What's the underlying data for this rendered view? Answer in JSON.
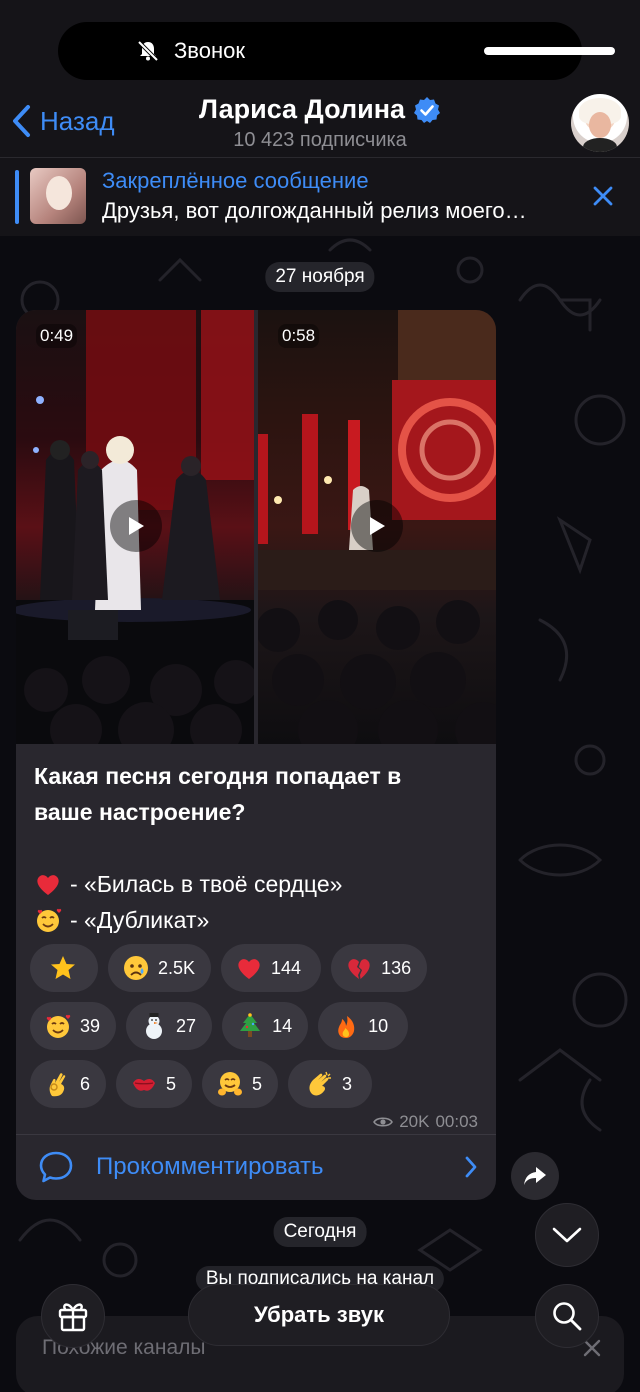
{
  "status_pill": {
    "text": "Звонок",
    "icon": "bell-slash-icon"
  },
  "header": {
    "back_label": "Назад",
    "title": "Лариса Долина",
    "subtitle": "10 423 подписчика",
    "accent": "#3e8cf6"
  },
  "pinned": {
    "title": "Закреплённое сообщение",
    "text": "Друзья, вот долгожданный релиз моего…"
  },
  "date_separator": "27 ноября",
  "post": {
    "videos": [
      {
        "duration": "0:49"
      },
      {
        "duration": "0:58"
      }
    ],
    "question_line1": "Какая песня сегодня попадает в",
    "question_line2": "ваше настроение?",
    "options": [
      {
        "emoji": "red-heart",
        "text": "- «Билась в твоё сердце»"
      },
      {
        "emoji": "smiling-face-with-hearts",
        "text": "- «Дубликат»"
      }
    ],
    "reactions": [
      {
        "emoji": "star",
        "count": ""
      },
      {
        "emoji": "crying-face",
        "count": "2.5K"
      },
      {
        "emoji": "red-heart",
        "count": "144"
      },
      {
        "emoji": "broken-heart",
        "count": "136"
      },
      {
        "emoji": "smiling-face-with-hearts",
        "count": "39"
      },
      {
        "emoji": "snowman",
        "count": "27"
      },
      {
        "emoji": "christmas-tree",
        "count": "14"
      },
      {
        "emoji": "fire",
        "count": "10"
      },
      {
        "emoji": "ok-hand",
        "count": "6"
      },
      {
        "emoji": "kiss-mark",
        "count": "5"
      },
      {
        "emoji": "hugging-face",
        "count": "5"
      },
      {
        "emoji": "clapping-hands",
        "count": "3"
      }
    ],
    "views": "20K",
    "time": "00:03",
    "comment_label": "Прокомментировать"
  },
  "today_separator": "Сегодня",
  "service_message": "Вы подписались на канал",
  "similar_title": "Похожие каналы",
  "mute_label": "Убрать звук"
}
